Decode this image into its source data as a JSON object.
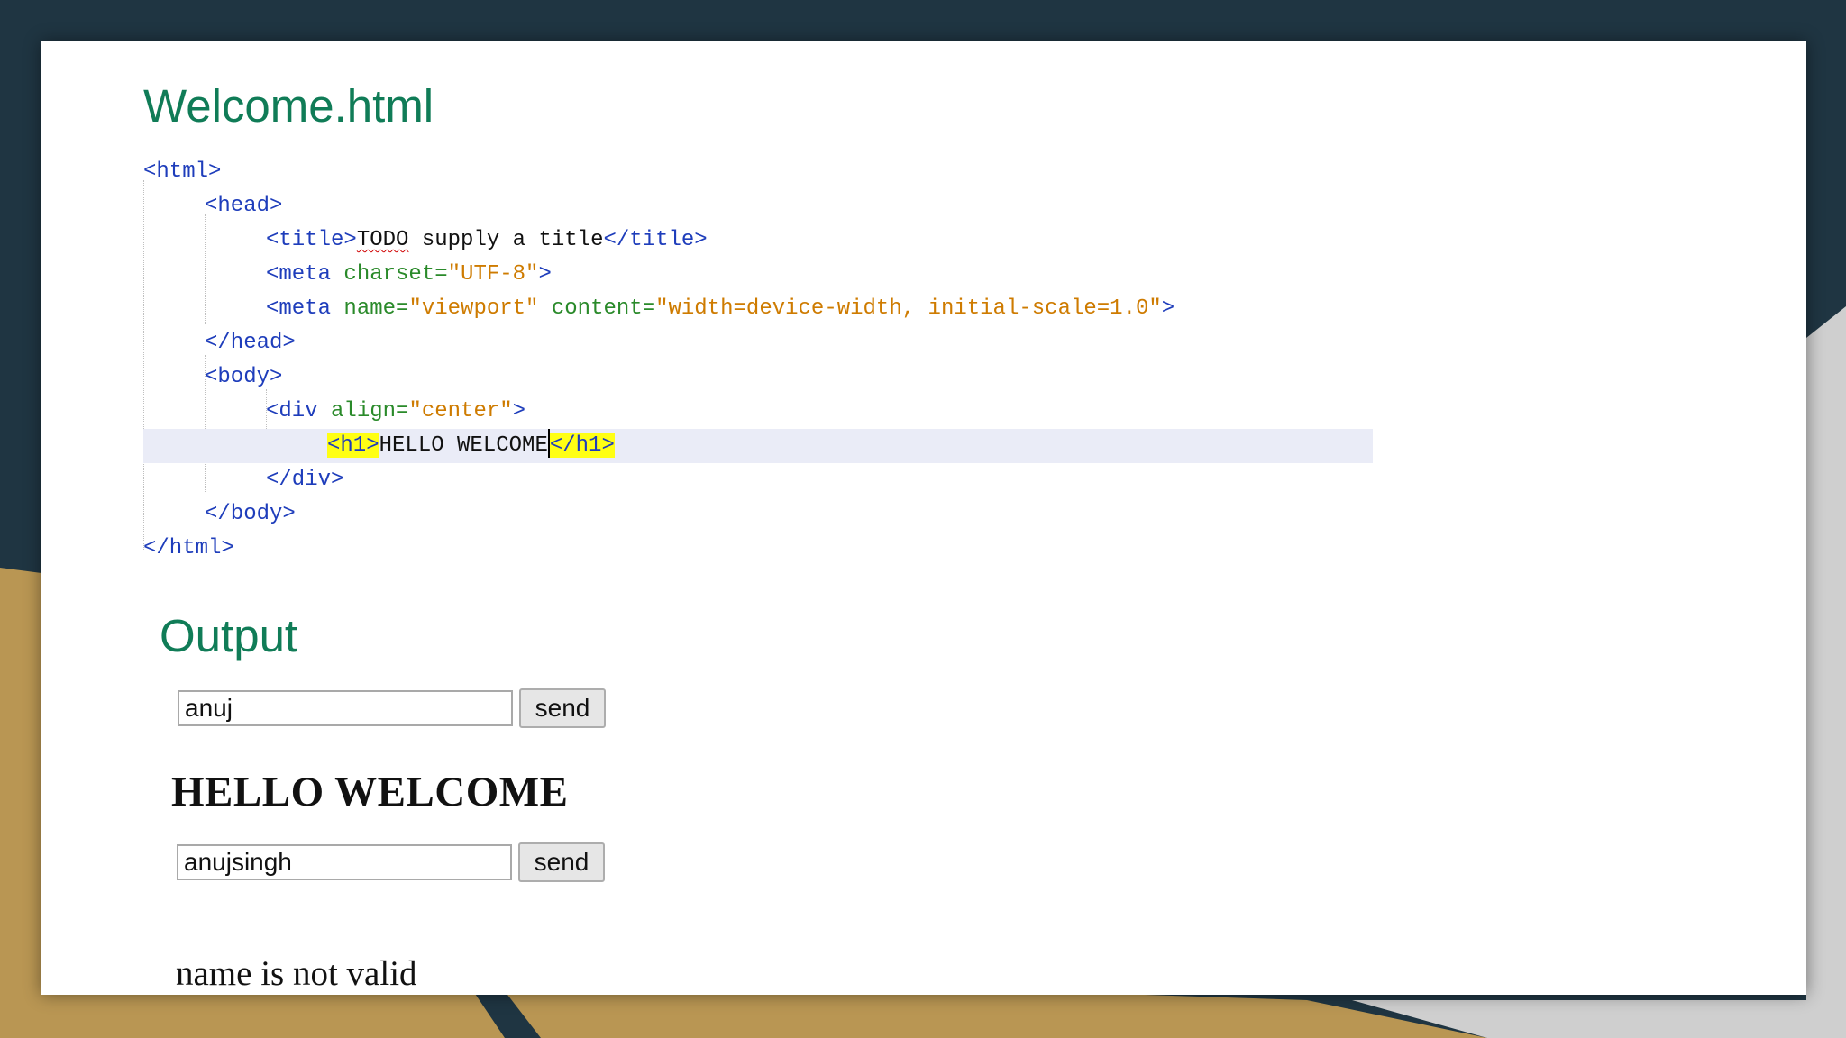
{
  "slide": {
    "title": "Welcome.html",
    "output_heading": "Output"
  },
  "code": {
    "l1_tag": "<html>",
    "l2_tag": "<head>",
    "l3_open": "<title>",
    "l3_todo": "TODO",
    "l3_text": " supply a title",
    "l3_close": "</title>",
    "l4_tag": "<meta ",
    "l4_attr": "charset=",
    "l4_val": "\"UTF-8\"",
    "l4_end": ">",
    "l5_tag": "<meta ",
    "l5_attr1": "name=",
    "l5_val1": "\"viewport\"",
    "l5_attr2": " content=",
    "l5_val2": "\"width=device-width, initial-scale=1.0\"",
    "l5_end": ">",
    "l6_tag": "</head>",
    "l7_tag": "<body>",
    "l8_tag": "<div ",
    "l8_attr": "align=",
    "l8_val": "\"center\"",
    "l8_end": ">",
    "l9_open": "<h1>",
    "l9_text": "HELLO WELCOME",
    "l9_close": "</h1>",
    "l10_tag": "</div>",
    "l11_tag": "</body>",
    "l12_tag": "</html>"
  },
  "output": {
    "input1_value": "anuj",
    "send1_label": "send",
    "heading": "HELLO WELCOME",
    "input2_value": "anujsingh",
    "send2_label": "send",
    "message": "name is not valid"
  },
  "colors": {
    "heading_green": "#107c57",
    "code_tag": "#1e3dbb",
    "code_attr": "#2a8a2a",
    "code_value": "#ce7b00",
    "match_highlight": "#ffff14"
  }
}
